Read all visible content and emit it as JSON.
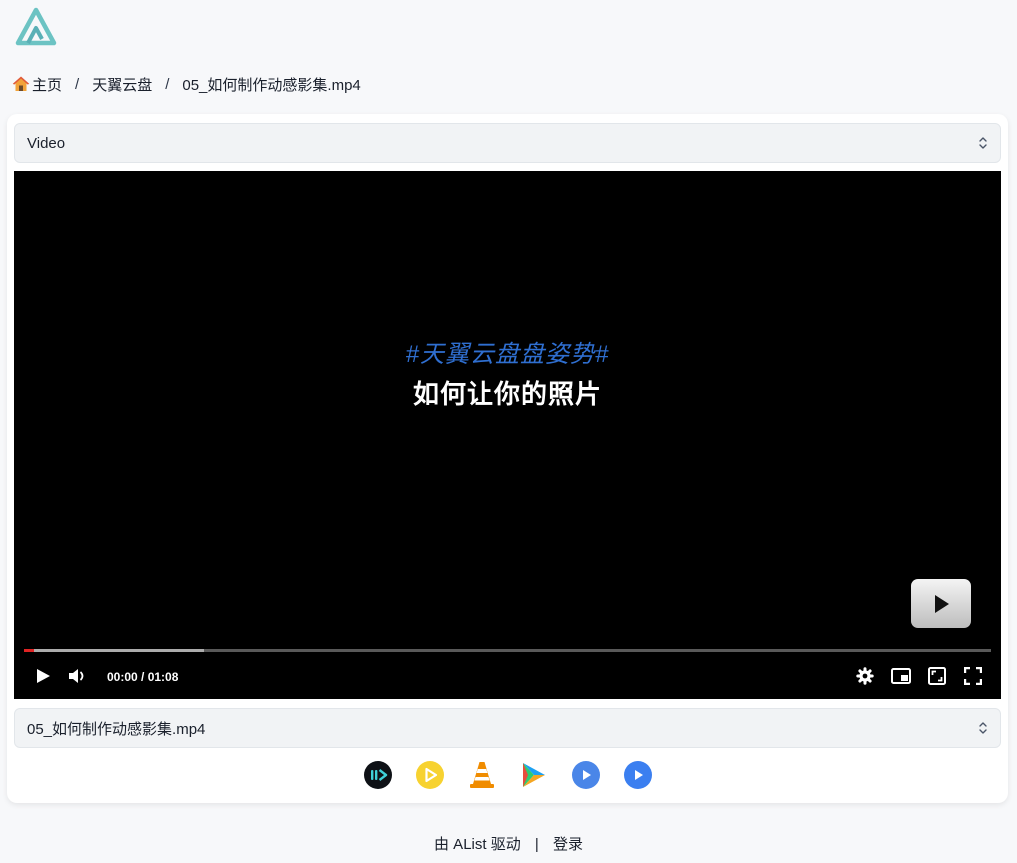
{
  "breadcrumb": {
    "home": "主页",
    "folder": "天翼云盘",
    "file": "05_如何制作动感影集.mp4",
    "separator": "/"
  },
  "preview_select": {
    "value": "Video"
  },
  "player": {
    "hashtag": "#天翼云盘盘姿势#",
    "headline": "如何让你的照片",
    "time": "00:00 / 01:08",
    "played_fraction": 0.01,
    "buffered_fraction": 0.186
  },
  "file_select": {
    "value": "05_如何制作动感影集.mp4"
  },
  "external_players": [
    {
      "icon": "iina-icon"
    },
    {
      "icon": "potplayer-icon"
    },
    {
      "icon": "vlc-icon"
    },
    {
      "icon": "nplayer-icon"
    },
    {
      "icon": "omniplayer-icon"
    },
    {
      "icon": "fileball-icon"
    }
  ],
  "footer": {
    "powered_by": "由 AList 驱动",
    "separator": "|",
    "login": "登录"
  },
  "colors": {
    "accent_blue": "#2f6fd1",
    "progress_red": "#e02424",
    "logo_teal": "#6cc3c3"
  }
}
